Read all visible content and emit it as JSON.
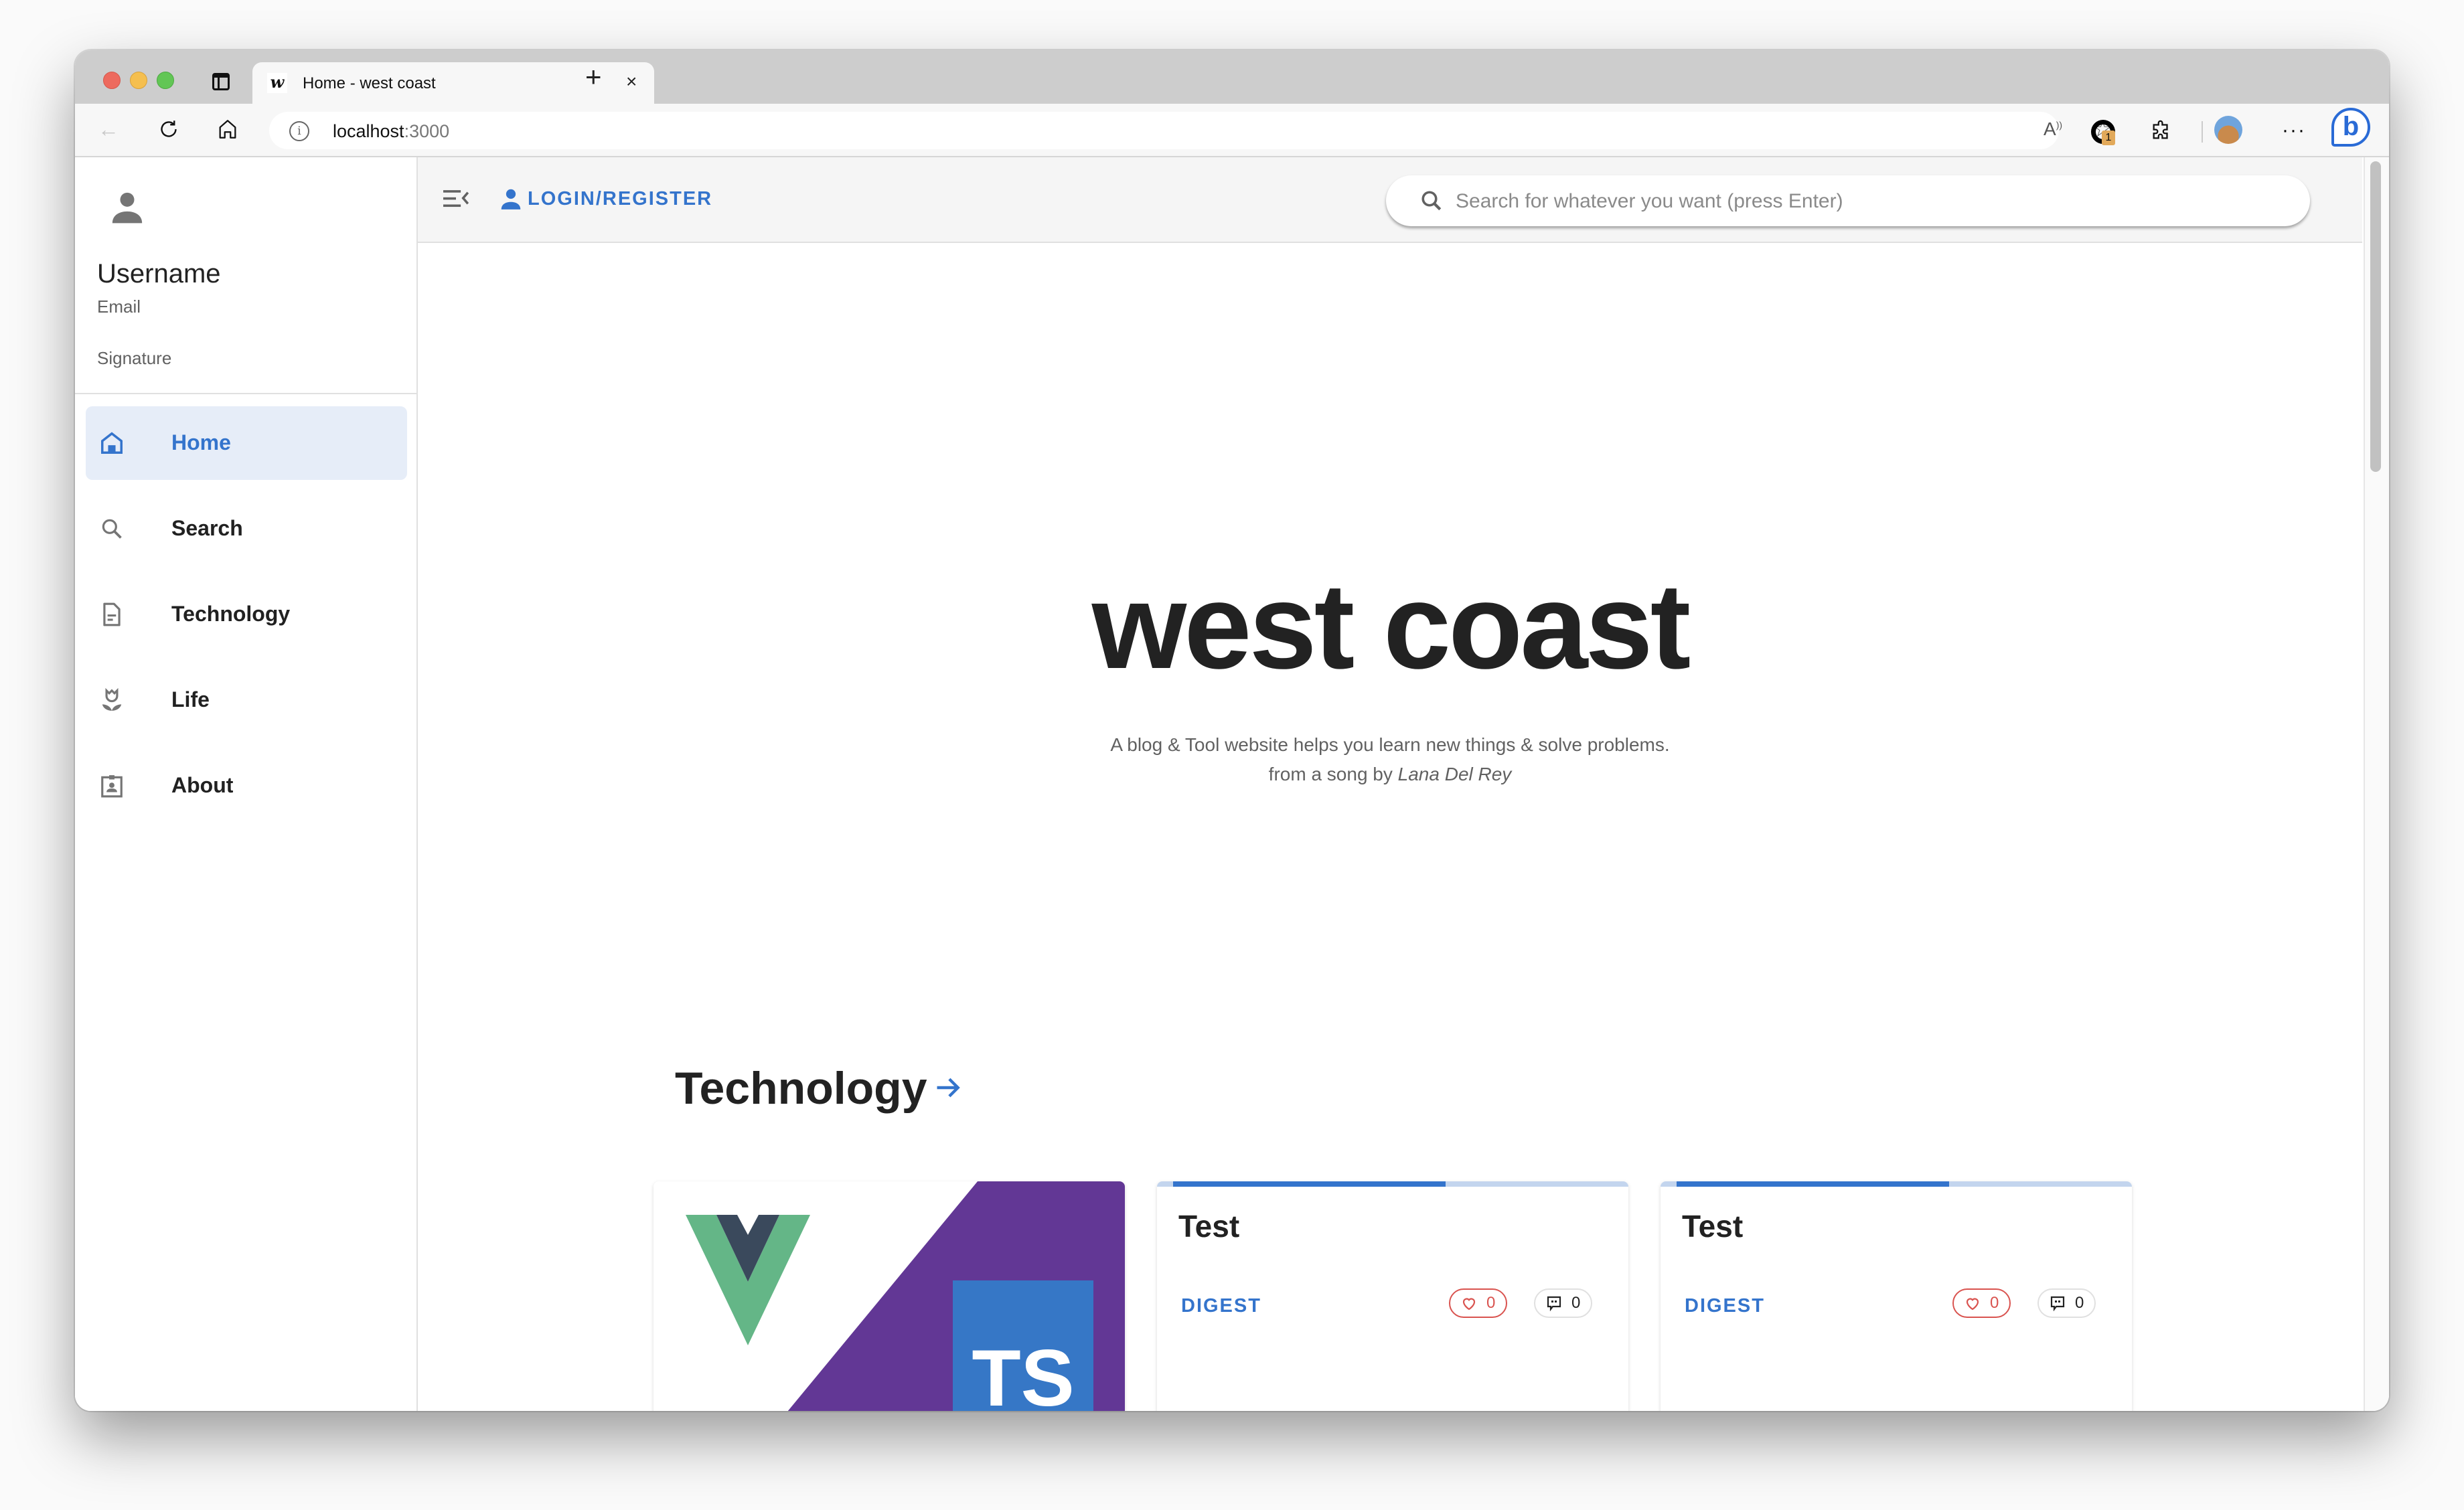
{
  "browser": {
    "tab_title": "Home - west coast",
    "tab_favicon": "w",
    "new_tab_icon": "plus-icon",
    "url_host": "localhost",
    "url_port": ":3000",
    "extension_badge": "1",
    "more_label": "···",
    "bing_label": "b"
  },
  "sidebar": {
    "username": "Username",
    "email": "Email",
    "signature": "Signature",
    "items": [
      {
        "label": "Home",
        "icon": "home-icon",
        "active": true
      },
      {
        "label": "Search",
        "icon": "search-icon",
        "active": false
      },
      {
        "label": "Technology",
        "icon": "document-icon",
        "active": false
      },
      {
        "label": "Life",
        "icon": "flower-icon",
        "active": false
      },
      {
        "label": "About",
        "icon": "badge-icon",
        "active": false
      }
    ]
  },
  "appbar": {
    "login_label": "LOGIN/REGISTER",
    "search_placeholder": "Search for whatever you want (press Enter)",
    "search_value": ""
  },
  "hero": {
    "title": "west coast",
    "subtitle": "A blog & Tool website helps you learn new things & solve problems.",
    "credit_prefix": "from a song by ",
    "credit_artist": "Lana Del Rey"
  },
  "section": {
    "title": "Technology"
  },
  "cards": [
    {
      "type": "image",
      "image_text": "TS",
      "image_desc": "Vue + TypeScript"
    },
    {
      "title": "Test",
      "tag": "DIGEST",
      "likes": "0",
      "comments": "0",
      "progress": 0.62
    },
    {
      "title": "Test",
      "tag": "DIGEST",
      "likes": "0",
      "comments": "0",
      "progress": 0.62
    }
  ],
  "colors": {
    "accent": "#3474cc",
    "like": "#d9534f",
    "vue_green": "#64b687",
    "vue_dark": "#3a495c",
    "ts_purple": "#623795",
    "ts_blue": "#3677c6"
  }
}
